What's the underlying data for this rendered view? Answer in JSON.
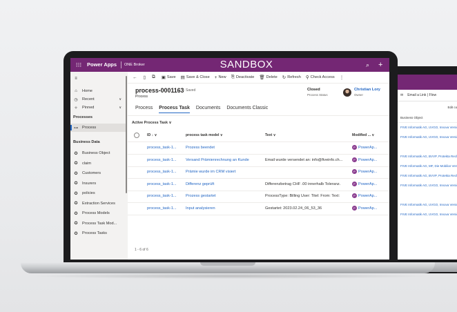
{
  "app": {
    "name": "Power Apps",
    "environment": "ONE Broker",
    "banner": "SANDBOX",
    "brand_color": "#742774",
    "accent_color": "#2266c4"
  },
  "sidebar": {
    "items": [
      {
        "label": "Home",
        "icon": "home-icon"
      },
      {
        "label": "Recent",
        "icon": "clock-icon"
      },
      {
        "label": "Pinned",
        "icon": "pin-icon"
      }
    ],
    "processes_heading": "Processes",
    "process_item": {
      "label": "Process",
      "icon": "process-icon"
    },
    "business_heading": "Business Data",
    "business_items": [
      {
        "label": "Business Object",
        "icon": "puzzle-icon"
      },
      {
        "label": "claim",
        "icon": "puzzle-icon"
      },
      {
        "label": "Customers",
        "icon": "puzzle-icon"
      },
      {
        "label": "Insurers",
        "icon": "puzzle-icon"
      },
      {
        "label": "policies",
        "icon": "puzzle-icon"
      },
      {
        "label": "Extraction Services",
        "icon": "puzzle-icon"
      },
      {
        "label": "Process Models",
        "icon": "puzzle-icon"
      },
      {
        "label": "Process Task Mod...",
        "icon": "puzzle-icon"
      },
      {
        "label": "Process Tasks",
        "icon": "puzzle-icon"
      }
    ]
  },
  "commands": {
    "save": "Save",
    "save_close": "Save & Close",
    "new": "New",
    "deactivate": "Deactivate",
    "delete": "Delete",
    "refresh": "Refresh",
    "check_access": "Check Access"
  },
  "record": {
    "title": "process-0001163",
    "saved": "- Saved",
    "entity": "Process",
    "status_value": "Closed",
    "status_label": "Process Status",
    "owner_name": "Christian Lory",
    "owner_label": "Owner"
  },
  "tabs": [
    "Process",
    "Process Task",
    "Documents",
    "Documents Classic"
  ],
  "active_tab": "Process Task",
  "grid": {
    "view_name": "Active Process Task",
    "headers": {
      "id": "ID",
      "model": "process task model",
      "text": "Text",
      "modified": "Modified ..."
    },
    "rows": [
      {
        "id": "process_task-1...",
        "model": "Prozess beendet",
        "text": "",
        "modified": "PowerAp..."
      },
      {
        "id": "process_task-1...",
        "model": "Versand Prämienrechnung an Kunde",
        "text": "Email wurde versendet an: info@fiveinfo.ch...",
        "modified": "PowerAp..."
      },
      {
        "id": "process_task-1...",
        "model": "Prämie wurde im CRM visiert",
        "text": "",
        "modified": "PowerAp..."
      },
      {
        "id": "process_task-1...",
        "model": "Differenz geprüft",
        "text": "Differenzbetrag CHF .00 innerhalb Toleranz.",
        "modified": "PowerAp..."
      },
      {
        "id": "process_task-1...",
        "model": "Prozess gestartet",
        "text": "ProcessType: Billing User: Titel: From: Text:",
        "modified": "PowerAp..."
      },
      {
        "id": "process_task-1...",
        "model": "Input analysieren",
        "text": "Gestartet: 2023.02.24_06_53_36",
        "modified": "PowerAp..."
      }
    ],
    "footer": "1 - 6 of 6"
  },
  "second_screen": {
    "commands": "Email a Link  |  Flow",
    "edit_columns": "Edit column",
    "header": "Business Object",
    "rows": [
      "FIVE Informatik AG, UVGO, Innova Versich",
      "FIVE Informatik AG, UVGO, Innova Versich",
      "",
      "FIVE Informatik AG, BVVP, Protekta Recht",
      "FIVE Informatik AG, MF, Die Mobiliar Vers",
      "FIVE Informatik AG, BVVP, Protekta Recht",
      "FIVE Informatik AG, UVGO, Innova Versich",
      "",
      "FIVE Informatik AG, UVGO, Innova Versich",
      "FIVE Informatik AG, UVGO, Innova Versich"
    ]
  }
}
